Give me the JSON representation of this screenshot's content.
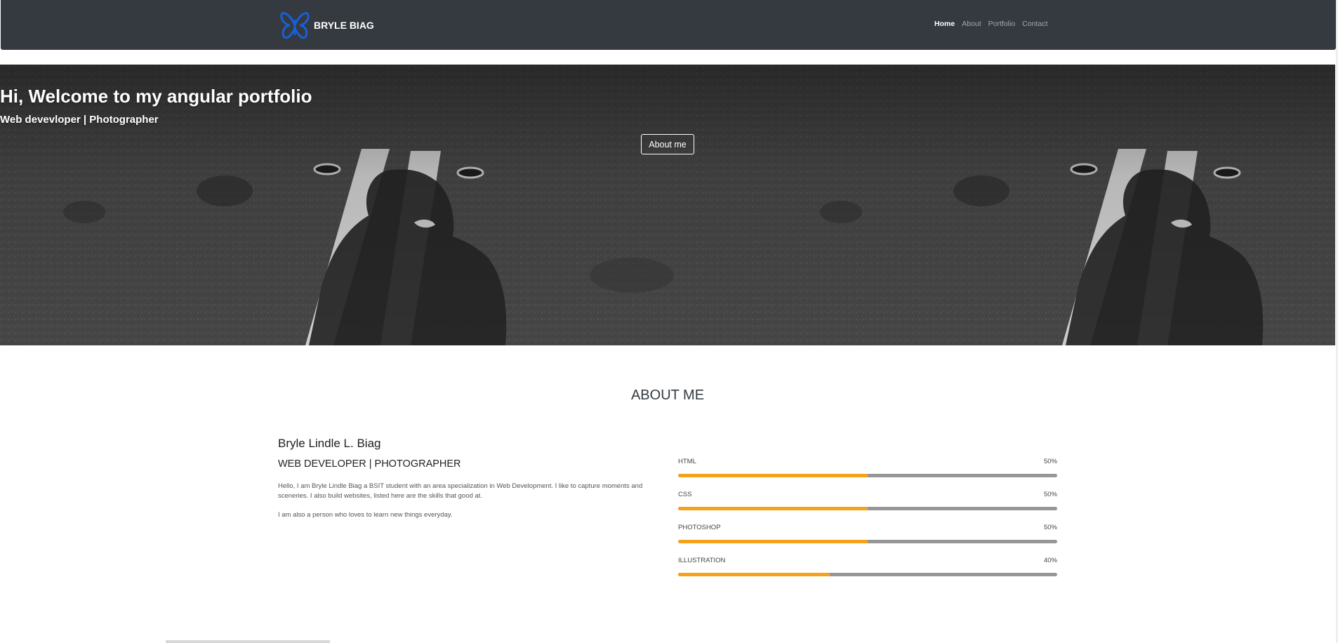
{
  "navbar": {
    "brand": "BRYLE BIAG",
    "links": [
      {
        "label": "Home",
        "active": true
      },
      {
        "label": "About",
        "active": false
      },
      {
        "label": "Portfolio",
        "active": false
      },
      {
        "label": "Contact",
        "active": false
      }
    ],
    "logo_icon": "butterfly-icon",
    "logo_color": "#1a5fd8"
  },
  "hero": {
    "title": "Hi, Welcome to my angular portfolio",
    "subtitle": "Web devevloper | Photographer",
    "button_label": "About me"
  },
  "about": {
    "heading": "ABOUT ME",
    "name": "Bryle Lindle L. Biag",
    "role": "WEB DEVELOPER | PHOTOGRAPHER",
    "paragraph1": "Hello, I am Bryle Lindle Biag a BSIT student with an area specialization in Web Development. I like to capture moments and sceneries. I also build websites, listed here are the skills that good at.",
    "paragraph2": "I am also a person who loves to learn new things everyday."
  },
  "skills": [
    {
      "name": "HTML",
      "percent_label": "50%",
      "level": 0.5
    },
    {
      "name": "CSS",
      "percent_label": "50%",
      "level": 0.5
    },
    {
      "name": "PHOTOSHOP",
      "percent_label": "50%",
      "level": 0.5
    },
    {
      "name": "ILLUSTRATION",
      "percent_label": "40%",
      "level": 0.4
    }
  ],
  "colors": {
    "navbar_bg": "#343a40",
    "skill_fill": "#f5a21a",
    "skill_track": "#969696"
  }
}
